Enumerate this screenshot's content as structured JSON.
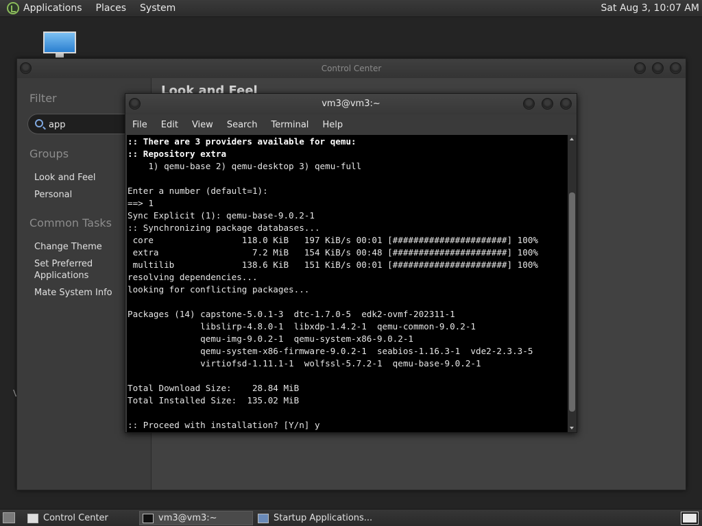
{
  "top_panel": {
    "menus": [
      "Applications",
      "Places",
      "System"
    ],
    "clock": "Sat Aug  3, 10:07 AM"
  },
  "control_center": {
    "title": "Control Center",
    "filter_heading": "Filter",
    "search_value": "app",
    "groups_heading": "Groups",
    "groups": [
      "Look and Feel",
      "Personal"
    ],
    "common_tasks_heading": "Common Tasks",
    "common_tasks": [
      "Change Theme",
      "Set Preferred",
      "Applications",
      "Mate System Info"
    ],
    "section_title": "Look and Feel"
  },
  "terminal": {
    "title": "vm3@vm3:~",
    "menus": [
      "File",
      "Edit",
      "View",
      "Search",
      "Terminal",
      "Help"
    ],
    "lines": [
      {
        "text": ":: There are 3 providers available for qemu:",
        "bold": true
      },
      {
        "text": ":: Repository extra",
        "bold": true
      },
      {
        "text": "    1) qemu-base 2) qemu-desktop 3) qemu-full",
        "bold": false
      },
      {
        "text": "",
        "bold": false
      },
      {
        "text": "Enter a number (default=1):",
        "bold": false
      },
      {
        "text": "==> 1",
        "bold": false
      },
      {
        "text": "Sync Explicit (1): qemu-base-9.0.2-1",
        "bold": false
      },
      {
        "text": ":: Synchronizing package databases...",
        "bold": false
      },
      {
        "text": " core                 118.0 KiB   197 KiB/s 00:01 [######################] 100%",
        "bold": false
      },
      {
        "text": " extra                  7.2 MiB   154 KiB/s 00:48 [######################] 100%",
        "bold": false
      },
      {
        "text": " multilib             138.6 KiB   151 KiB/s 00:01 [######################] 100%",
        "bold": false
      },
      {
        "text": "resolving dependencies...",
        "bold": false
      },
      {
        "text": "looking for conflicting packages...",
        "bold": false
      },
      {
        "text": "",
        "bold": false
      },
      {
        "text": "Packages (14) capstone-5.0.1-3  dtc-1.7.0-5  edk2-ovmf-202311-1",
        "bold": false
      },
      {
        "text": "              libslirp-4.8.0-1  libxdp-1.4.2-1  qemu-common-9.0.2-1",
        "bold": false
      },
      {
        "text": "              qemu-img-9.0.2-1  qemu-system-x86-9.0.2-1",
        "bold": false
      },
      {
        "text": "              qemu-system-x86-firmware-9.0.2-1  seabios-1.16.3-1  vde2-2.3.3-5",
        "bold": false
      },
      {
        "text": "              virtiofsd-1.11.1-1  wolfssl-5.7.2-1  qemu-base-9.0.2-1",
        "bold": false
      },
      {
        "text": "",
        "bold": false
      },
      {
        "text": "Total Download Size:    28.84 MiB",
        "bold": false
      },
      {
        "text": "Total Installed Size:  135.02 MiB",
        "bold": false
      },
      {
        "text": "",
        "bold": false
      },
      {
        "text": ":: Proceed with installation? [Y/n] y",
        "bold": false
      }
    ]
  },
  "taskbar": {
    "tasks": [
      {
        "label": "Control Center",
        "icon": "control-center-icon",
        "active": false
      },
      {
        "label": "vm3@vm3:~",
        "icon": "terminal-icon",
        "active": true
      },
      {
        "label": "Startup Applications...",
        "icon": "startup-applications-icon",
        "active": false
      }
    ]
  },
  "desktop": {
    "stray_text": "V"
  }
}
